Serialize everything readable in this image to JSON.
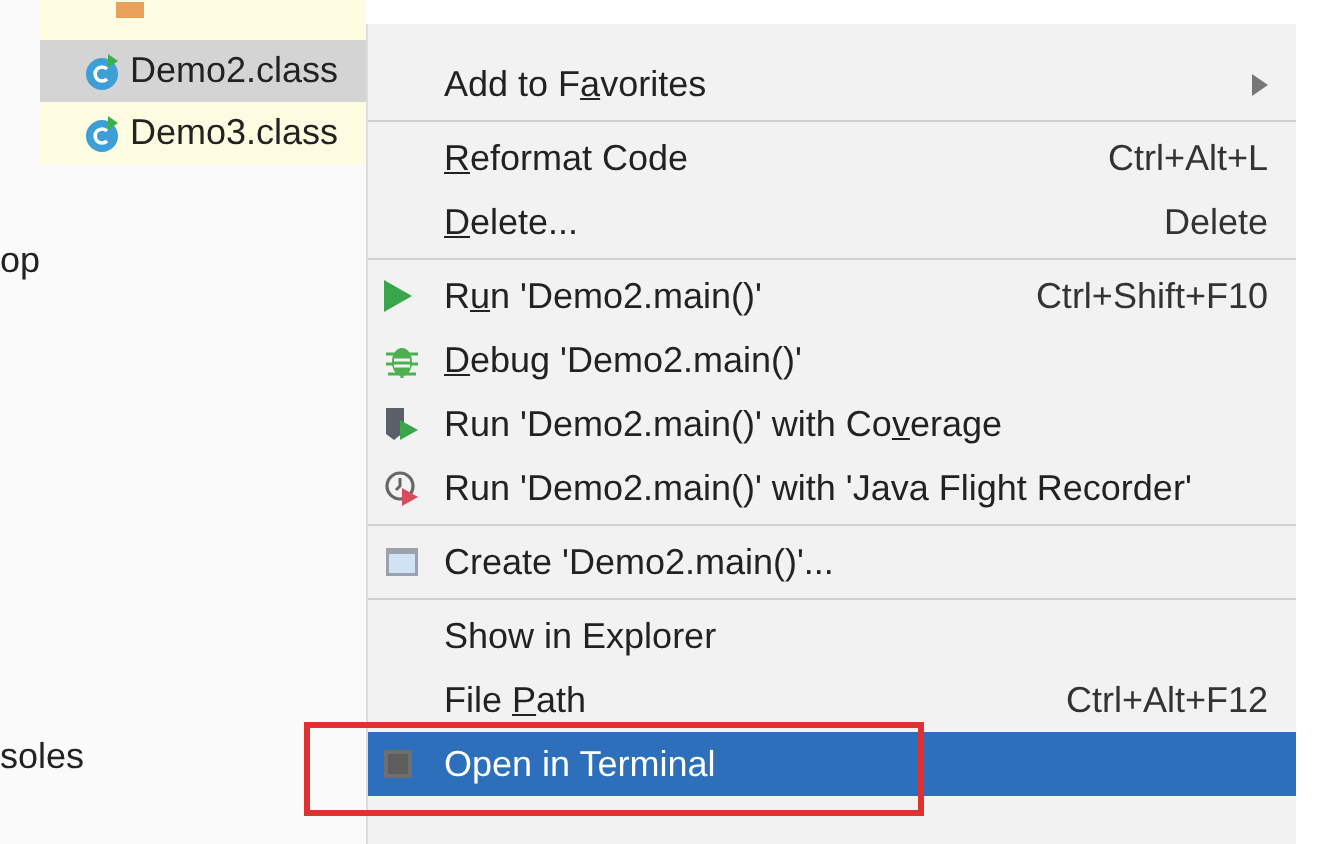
{
  "tree": {
    "items": [
      {
        "label": "Demo2.class",
        "selected": true
      },
      {
        "label": "Demo3.class",
        "selected": false
      }
    ]
  },
  "side_texts": [
    "op",
    "soles"
  ],
  "menu": {
    "items": [
      {
        "kind": "plain",
        "label": {
          "pre": "Add to F",
          "key": "a",
          "post": "vorites"
        },
        "submenu": true,
        "selected": false
      },
      {
        "kind": "separator"
      },
      {
        "kind": "plain",
        "label": {
          "key": "R",
          "post": "eformat Code"
        },
        "shortcut": "Ctrl+Alt+L",
        "selected": false
      },
      {
        "kind": "plain",
        "label": {
          "key": "D",
          "post": "elete..."
        },
        "shortcut": "Delete",
        "selected": false
      },
      {
        "kind": "separator"
      },
      {
        "kind": "run",
        "label": {
          "pre": "R",
          "key": "u",
          "post": "n 'Demo2.main()'"
        },
        "shortcut": "Ctrl+Shift+F10",
        "selected": false
      },
      {
        "kind": "debug",
        "label": {
          "key": "D",
          "post": "ebug 'Demo2.main()'"
        },
        "selected": false
      },
      {
        "kind": "coverage",
        "label": {
          "pre": "Run 'Demo2.main()' with Co",
          "key": "v",
          "post": "erage"
        },
        "selected": false
      },
      {
        "kind": "recorder",
        "label": {
          "pre": "Run 'Demo2.main()' with 'Java Flight Recorder'"
        },
        "selected": false
      },
      {
        "kind": "separator"
      },
      {
        "kind": "create",
        "label": {
          "pre": "Create 'Demo2.main()'..."
        },
        "selected": false
      },
      {
        "kind": "separator"
      },
      {
        "kind": "plain",
        "label": {
          "pre": "Show in Explorer"
        },
        "selected": false
      },
      {
        "kind": "plain",
        "label": {
          "pre": "File ",
          "key": "P",
          "post": "ath"
        },
        "shortcut": "Ctrl+Alt+F12",
        "selected": false
      },
      {
        "kind": "terminal",
        "label": {
          "pre": "Open in Terminal"
        },
        "selected": true
      }
    ]
  }
}
